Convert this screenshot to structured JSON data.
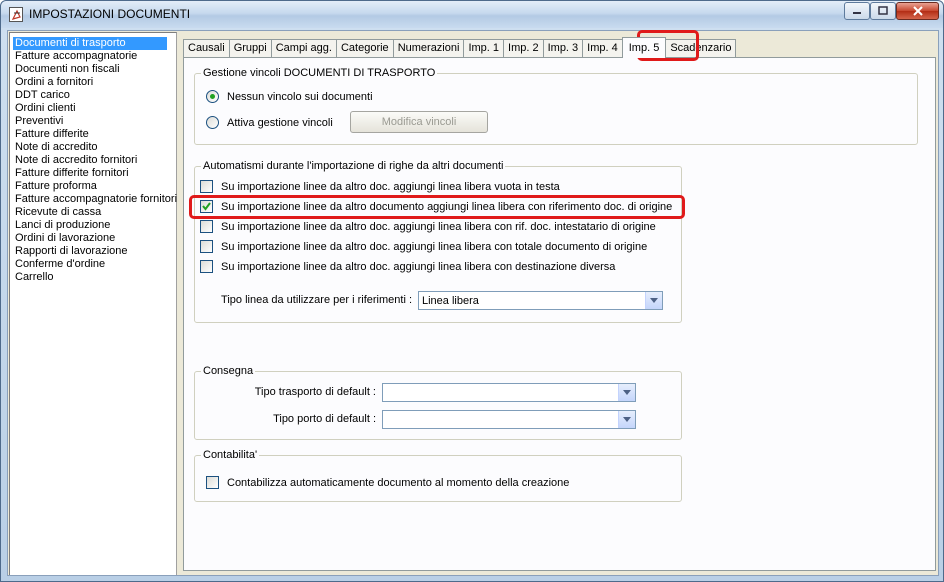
{
  "window": {
    "title": "IMPOSTAZIONI DOCUMENTI",
    "controls": {
      "minimize": "minimize-icon",
      "maximize": "maximize-icon",
      "close": "close-icon"
    }
  },
  "sidebar": {
    "items": [
      {
        "label": "Documenti di trasporto",
        "selected": true
      },
      {
        "label": "Fatture accompagnatorie"
      },
      {
        "label": "Documenti non fiscali"
      },
      {
        "label": "Ordini a fornitori"
      },
      {
        "label": "DDT carico"
      },
      {
        "label": "Ordini clienti"
      },
      {
        "label": "Preventivi"
      },
      {
        "label": "Fatture differite"
      },
      {
        "label": "Note di accredito"
      },
      {
        "label": "Note di accredito fornitori"
      },
      {
        "label": "Fatture differite fornitori"
      },
      {
        "label": "Fatture proforma"
      },
      {
        "label": "Fatture accompagnatorie fornitori"
      },
      {
        "label": "Ricevute di cassa"
      },
      {
        "label": "Lanci di produzione"
      },
      {
        "label": "Ordini di lavorazione"
      },
      {
        "label": "Rapporti di lavorazione"
      },
      {
        "label": "Conferme d'ordine"
      },
      {
        "label": "Carrello"
      }
    ]
  },
  "tabs": [
    {
      "label": "Causali"
    },
    {
      "label": "Gruppi"
    },
    {
      "label": "Campi agg."
    },
    {
      "label": "Categorie"
    },
    {
      "label": "Numerazioni"
    },
    {
      "label": "Imp. 1"
    },
    {
      "label": "Imp. 2"
    },
    {
      "label": "Imp. 3"
    },
    {
      "label": "Imp. 4"
    },
    {
      "label": "Imp. 5",
      "active": true
    },
    {
      "label": "Scadenzario"
    }
  ],
  "vincoli": {
    "legend": "Gestione vincoli DOCUMENTI DI TRASPORTO",
    "radio_none": "Nessun vincolo sui documenti",
    "radio_none_checked": true,
    "radio_active": "Attiva gestione vincoli",
    "radio_active_checked": false,
    "modify_button": "Modifica vincoli"
  },
  "automatismi": {
    "legend": "Automatismi durante l'importazione di righe da altri documenti",
    "options": [
      {
        "label": "Su importazione linee da altro doc. aggiungi linea libera vuota in testa",
        "checked": false
      },
      {
        "label": "Su importazione linee da altro documento aggiungi linea libera con riferimento doc. di origine",
        "checked": true
      },
      {
        "label": "Su importazione linee da altro doc. aggiungi linea libera con rif. doc. intestatario di origine",
        "checked": false
      },
      {
        "label": "Su importazione linee da altro doc. aggiungi linea libera con totale documento di origine",
        "checked": false
      },
      {
        "label": "Su importazione linee da altro doc. aggiungi linea libera con destinazione diversa",
        "checked": false
      }
    ],
    "tipo_linea_label": "Tipo linea da utilizzare per i riferimenti :",
    "tipo_linea_value": "Linea libera"
  },
  "consegna": {
    "legend": "Consegna",
    "trasporto_label": "Tipo trasporto di default :",
    "trasporto_value": "",
    "porto_label": "Tipo porto di default :",
    "porto_value": ""
  },
  "contabilita": {
    "legend": "Contabilita'",
    "option": "Contabilizza automaticamente documento al momento della creazione",
    "checked": false
  },
  "colors": {
    "selection": "#3399ff",
    "annotation": "#e01a1a",
    "panel": "#fcfcfe",
    "dialog": "#ece9d8"
  }
}
